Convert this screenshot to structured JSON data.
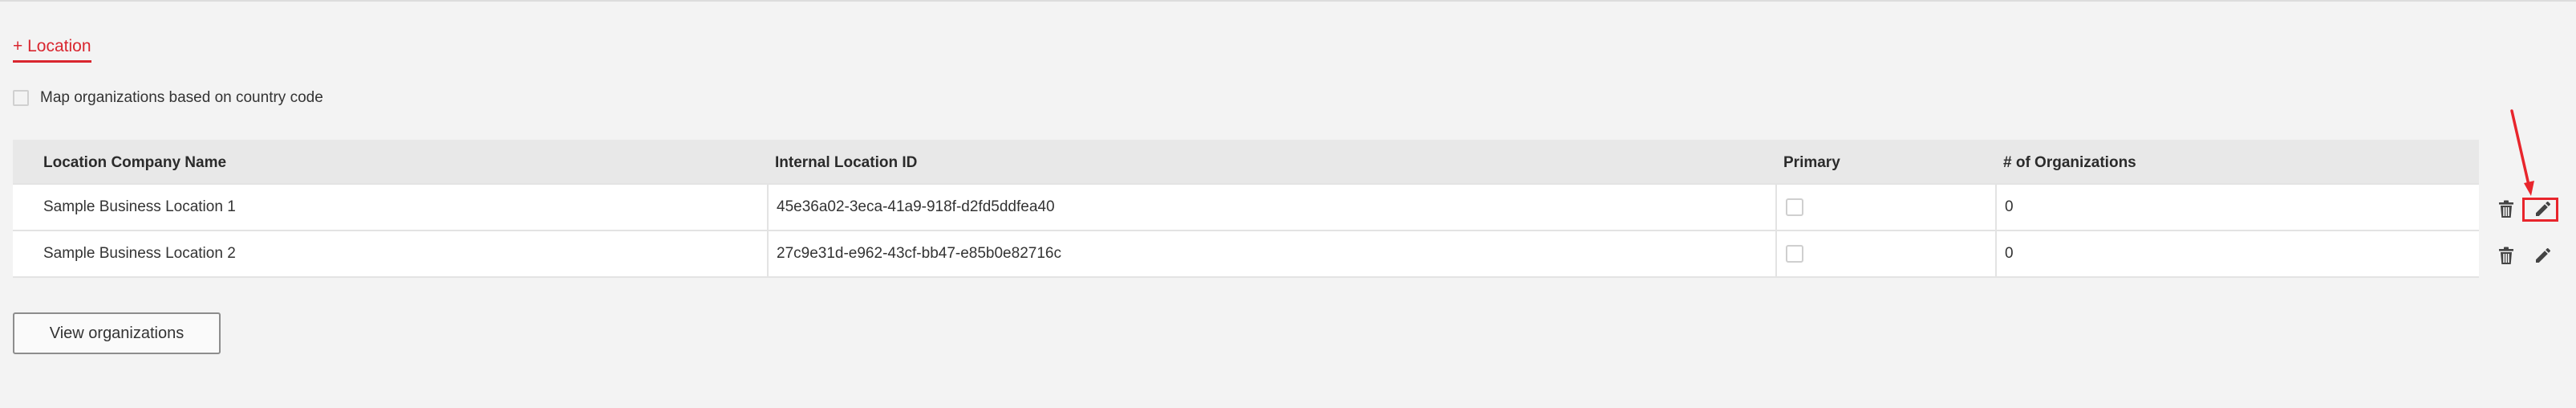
{
  "add_location_link": "+ Location",
  "map_by_country": {
    "checked": false,
    "label": "Map organizations based on country code"
  },
  "table": {
    "columns": [
      "Location Company Name",
      "Internal Location ID",
      "Primary",
      "# of Organizations"
    ],
    "rows": [
      {
        "name": "Sample Business Location 1",
        "internal_id": "45e36a02-3eca-41a9-918f-d2fd5ddfea40",
        "primary": false,
        "organizations": "0"
      },
      {
        "name": "Sample Business Location 2",
        "internal_id": "27c9e31d-e962-43cf-bb47-e85b0e82716c",
        "primary": false,
        "organizations": "0"
      }
    ],
    "row_actions": [
      "trash-icon",
      "pencil-edit-icon"
    ]
  },
  "view_organizations_button": "View organizations",
  "colors": {
    "accent": "#d9262f",
    "annotation": "#e8252c",
    "background": "#f3f3f3",
    "header_bg": "#e8e8e8"
  }
}
